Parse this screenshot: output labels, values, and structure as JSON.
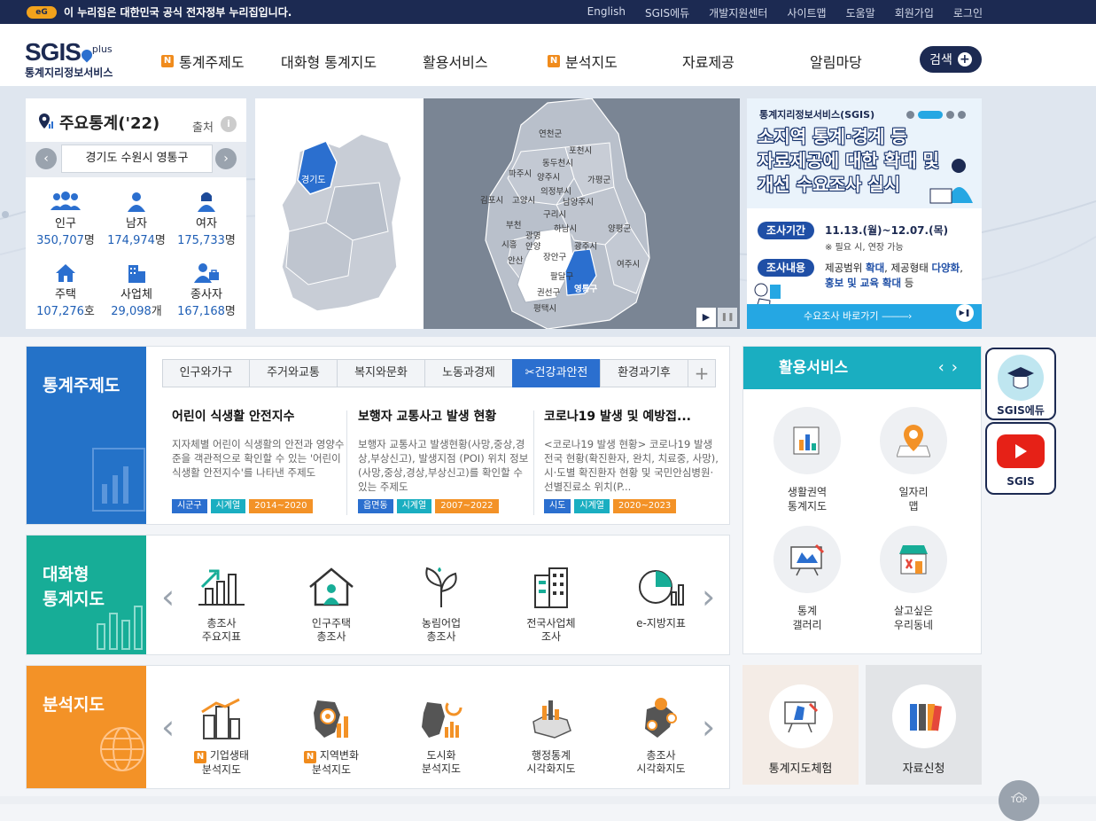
{
  "topbar": {
    "gov_logo": "eG",
    "gov_text": "이 누리집은 대한민국 공식 전자정부 누리집입니다.",
    "links": [
      "English",
      "SGIS에듀",
      "개발지원센터",
      "사이트맵",
      "도움말",
      "회원가입",
      "로그인"
    ]
  },
  "header": {
    "logo_main": "SGIS",
    "logo_plus": "plus",
    "logo_sub": "통계지리정보서비스",
    "nav": [
      {
        "label": "통계주제도",
        "badge": "N"
      },
      {
        "label": "대화형 통계지도",
        "badge": ""
      },
      {
        "label": "활용서비스",
        "badge": ""
      },
      {
        "label": "분석지도",
        "badge": "N"
      },
      {
        "label": "자료제공",
        "badge": ""
      },
      {
        "label": "알림마당",
        "badge": ""
      }
    ],
    "search_label": "검색",
    "search_icon": "plus-icon"
  },
  "stats": {
    "title": "주요통계('22)",
    "source_label": "출처",
    "info_icon": "i",
    "region": "경기도 수원시 영통구",
    "prev": "‹",
    "next": "›",
    "items": [
      {
        "label": "인구",
        "value": "350,707",
        "unit": "명",
        "icon": "people-icon"
      },
      {
        "label": "남자",
        "value": "174,974",
        "unit": "명",
        "icon": "man-icon"
      },
      {
        "label": "여자",
        "value": "175,733",
        "unit": "명",
        "icon": "woman-icon"
      },
      {
        "label": "주택",
        "value": "107,276",
        "unit": "호",
        "icon": "house-icon"
      },
      {
        "label": "사업체",
        "value": "29,098",
        "unit": "개",
        "icon": "building-icon"
      },
      {
        "label": "종사자",
        "value": "167,168",
        "unit": "명",
        "icon": "worker-icon"
      }
    ]
  },
  "map": {
    "province_label": "경기도",
    "labels": [
      "연천군",
      "포천시",
      "동두천시",
      "파주시",
      "양주시",
      "가평군",
      "의정부시",
      "김포시",
      "고양시",
      "남양주시",
      "구리시",
      "부천",
      "하남시",
      "양평군",
      "광명",
      "시흥",
      "안양",
      "광주시",
      "여주시",
      "안산",
      "장안구",
      "팔달구",
      "권선구",
      "영통구",
      "평택시"
    ],
    "selected": "영통구",
    "play": "▶",
    "pause": "❚❚"
  },
  "banner": {
    "org": "통계지리정보서비스(SGIS)",
    "headline_1": "소지역 통계·경계 등",
    "headline_2": "자료제공에 대한 확대 및",
    "headline_3": "개선 수요조사 실시",
    "period_tag": "조사기간",
    "period_value": "11.13.(월)~12.07.(목)",
    "period_note": "※ 필요 시, 연장 가능",
    "content_tag": "조사내용",
    "content_1a": "제공범위 ",
    "content_1b": "확대",
    "content_1c": ", 제공형태 ",
    "content_1d": "다양화",
    "content_1e": ",",
    "content_2a": "홍보 및 교육 확대",
    "content_2b": " 등",
    "cta": "수요조사 바로가기"
  },
  "theme": {
    "section_title": "통계주제도",
    "tabs": [
      "인구와가구",
      "주거와교통",
      "복지와문화",
      "노동과경제",
      "건강과안전",
      "환경과기후"
    ],
    "active_tab": "건강과안전",
    "add_tab": "+",
    "cards": [
      {
        "title": "어린이 식생활 안전지수",
        "desc": "지자체별 어린이 식생활의 안전과 영양수준을 객관적으로 확인할 수 있는 '어린이 식생활 안전지수'를 나타낸 주제도",
        "tags": [
          "시군구",
          "시계열",
          "2014~2020"
        ]
      },
      {
        "title": "보행자 교통사고 발생 현황",
        "desc": "보행자 교통사고 발생현황(사망,중상,경상,부상신고), 발생지점 (POI) 위치 정보(사망,중상,경상,부상신고)를 확인할 수 있는 주제도",
        "tags": [
          "읍면동",
          "시계열",
          "2007~2022"
        ]
      },
      {
        "title": "코로나19 발생 및 예방접...",
        "desc": "<코로나19 발생 현황> 코로나19 발생 전국 현황(확진환자, 완치, 치료중, 사망), 시·도별 확진환자 현황 및 국민안심병원·선별진료소 위치(P...",
        "tags": [
          "시도",
          "시계열",
          "2020~2023"
        ]
      }
    ]
  },
  "interactive": {
    "section_title_1": "대화형",
    "section_title_2": "통계지도",
    "items": [
      {
        "l1": "총조사",
        "l2": "주요지표",
        "icon": "bar-chart-icon"
      },
      {
        "l1": "인구주택",
        "l2": "총조사",
        "icon": "house-person-icon"
      },
      {
        "l1": "농림어업",
        "l2": "총조사",
        "icon": "leaf-icon"
      },
      {
        "l1": "전국사업체",
        "l2": "조사",
        "icon": "office-building-icon"
      },
      {
        "l1": "e-지방지표",
        "l2": "",
        "icon": "pie-chart-icon"
      }
    ]
  },
  "analysis": {
    "section_title": "분석지도",
    "items": [
      {
        "l1": "기업생태",
        "l2": "분석지도",
        "badge": "N",
        "icon": "company-icon"
      },
      {
        "l1": "지역변화",
        "l2": "분석지도",
        "badge": "N",
        "icon": "region-change-icon"
      },
      {
        "l1": "도시화",
        "l2": "분석지도",
        "badge": "",
        "icon": "urban-icon"
      },
      {
        "l1": "행정통계",
        "l2": "시각화지도",
        "badge": "",
        "icon": "admin-map-icon"
      },
      {
        "l1": "총조사",
        "l2": "시각화지도",
        "badge": "",
        "icon": "census-map-icon"
      }
    ]
  },
  "services": {
    "title": "활용서비스",
    "items": [
      {
        "l1": "생활권역",
        "l2": "통계지도",
        "icon": "area-chart-icon"
      },
      {
        "l1": "일자리",
        "l2": "맵",
        "icon": "job-map-icon"
      },
      {
        "l1": "통계",
        "l2": "갤러리",
        "icon": "gallery-icon"
      },
      {
        "l1": "살고싶은",
        "l2": "우리동네",
        "icon": "neighborhood-icon"
      }
    ]
  },
  "boxes": {
    "experience": "통계지도체험",
    "request": "자료신청"
  },
  "quick": {
    "edu": "SGIS에듀",
    "youtube": "SGIS"
  },
  "top_button": "TOP",
  "colors": {
    "navy": "#1c2a52",
    "blue": "#2b6fcf",
    "teal": "#17ad97",
    "orange": "#f39227",
    "cyan": "#1aaec1"
  }
}
